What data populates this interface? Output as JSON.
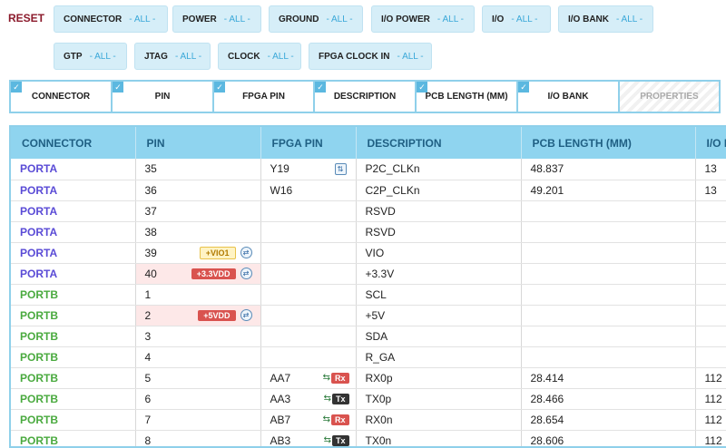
{
  "filters": {
    "reset_label": "RESET",
    "all_label": "- ALL -",
    "items": [
      {
        "label": "CONNECTOR"
      },
      {
        "label": "POWER"
      },
      {
        "label": "GROUND"
      },
      {
        "label": "I/O POWER"
      },
      {
        "label": "I/O"
      },
      {
        "label": "I/O BANK"
      },
      {
        "label": "GTP"
      },
      {
        "label": "JTAG"
      },
      {
        "label": "CLOCK"
      },
      {
        "label": "FPGA CLOCK IN"
      }
    ]
  },
  "column_toggles": [
    {
      "label": "CONNECTOR",
      "checked": true
    },
    {
      "label": "PIN",
      "checked": true
    },
    {
      "label": "FPGA PIN",
      "checked": true
    },
    {
      "label": "DESCRIPTION",
      "checked": true
    },
    {
      "label": "PCB LENGTH (MM)",
      "checked": true
    },
    {
      "label": "I/O BANK",
      "checked": true
    },
    {
      "label": "PROPERTIES",
      "checked": false
    }
  ],
  "table": {
    "headers": [
      "CONNECTOR",
      "PIN",
      "FPGA PIN",
      "DESCRIPTION",
      "PCB LENGTH (MM)",
      "I/O BANK"
    ],
    "rows": [
      {
        "connector": "PORTA",
        "pin": "35",
        "fpga_pin": "Y19",
        "description": "P2C_CLKn",
        "pcb_length": "48.837",
        "io_bank": "13"
      },
      {
        "connector": "PORTA",
        "pin": "36",
        "fpga_pin": "W16",
        "description": "C2P_CLKn",
        "pcb_length": "49.201",
        "io_bank": "13"
      },
      {
        "connector": "PORTA",
        "pin": "37",
        "fpga_pin": "",
        "description": "RSVD",
        "pcb_length": "",
        "io_bank": ""
      },
      {
        "connector": "PORTA",
        "pin": "38",
        "fpga_pin": "",
        "description": "RSVD",
        "pcb_length": "",
        "io_bank": ""
      },
      {
        "connector": "PORTA",
        "pin": "39",
        "pin_badge": "+VIO1",
        "fpga_pin": "",
        "description": "VIO",
        "pcb_length": "",
        "io_bank": ""
      },
      {
        "connector": "PORTA",
        "pin": "40",
        "pin_badge": "+3.3VDD",
        "fpga_pin": "",
        "description": "+3.3V",
        "pcb_length": "",
        "io_bank": ""
      },
      {
        "connector": "PORTB",
        "pin": "1",
        "fpga_pin": "",
        "description": "SCL",
        "pcb_length": "",
        "io_bank": ""
      },
      {
        "connector": "PORTB",
        "pin": "2",
        "pin_badge": "+5VDD",
        "fpga_pin": "",
        "description": "+5V",
        "pcb_length": "",
        "io_bank": ""
      },
      {
        "connector": "PORTB",
        "pin": "3",
        "fpga_pin": "",
        "description": "SDA",
        "pcb_length": "",
        "io_bank": ""
      },
      {
        "connector": "PORTB",
        "pin": "4",
        "fpga_pin": "",
        "description": "R_GA",
        "pcb_length": "",
        "io_bank": ""
      },
      {
        "connector": "PORTB",
        "pin": "5",
        "fpga_pin": "AA7",
        "signal": "Rx",
        "description": "RX0p",
        "pcb_length": "28.414",
        "io_bank": "112"
      },
      {
        "connector": "PORTB",
        "pin": "6",
        "fpga_pin": "AA3",
        "signal": "Tx",
        "description": "TX0p",
        "pcb_length": "28.466",
        "io_bank": "112"
      },
      {
        "connector": "PORTB",
        "pin": "7",
        "fpga_pin": "AB7",
        "signal": "Rx",
        "description": "RX0n",
        "pcb_length": "28.654",
        "io_bank": "112"
      },
      {
        "connector": "PORTB",
        "pin": "8",
        "fpga_pin": "AB3",
        "signal": "Tx",
        "description": "TX0n",
        "pcb_length": "28.606",
        "io_bank": "112"
      }
    ]
  },
  "colors": {
    "accent": "#8fd4ef",
    "porta": "#5a4bd6",
    "portb": "#4aaa3f",
    "reset": "#8b1a2b"
  }
}
